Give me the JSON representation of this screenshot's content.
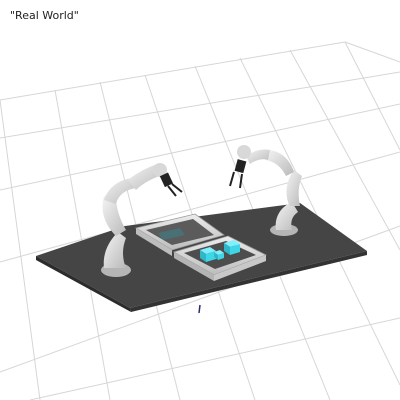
{
  "window": {
    "title": "\"Real World\""
  },
  "scene": {
    "table_color": "#444444",
    "table_edge_color": "#2e2e2e",
    "grid_color": "#cfcfcf",
    "robot_color": "#dcdcdc",
    "box_color": "#d9d9d9",
    "cube_color": "#3fd6e8"
  }
}
